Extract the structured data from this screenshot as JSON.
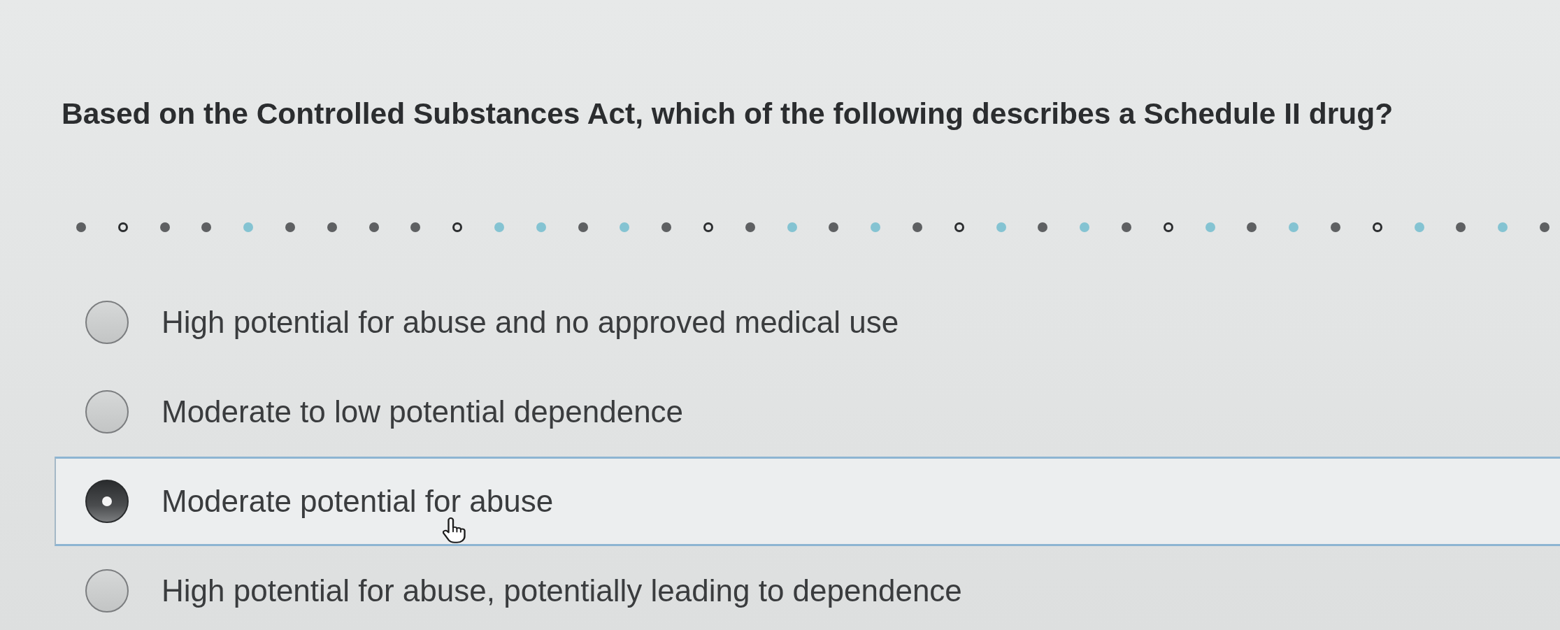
{
  "question": {
    "text": "Based on the Controlled Substances Act, which of the following describes a Schedule II drug?"
  },
  "progress_dots": [
    {
      "kind": "filled",
      "color": "#5e6062"
    },
    {
      "kind": "ring",
      "color": "#2c2e30"
    },
    {
      "kind": "filled",
      "color": "#5e6062"
    },
    {
      "kind": "filled",
      "color": "#5e6062"
    },
    {
      "kind": "filled",
      "color": "#84c3d2"
    },
    {
      "kind": "filled",
      "color": "#5e6062"
    },
    {
      "kind": "filled",
      "color": "#5e6062"
    },
    {
      "kind": "filled",
      "color": "#5e6062"
    },
    {
      "kind": "filled",
      "color": "#5e6062"
    },
    {
      "kind": "ring",
      "color": "#2c2e30"
    },
    {
      "kind": "filled",
      "color": "#84c3d2"
    },
    {
      "kind": "filled",
      "color": "#84c3d2"
    },
    {
      "kind": "filled",
      "color": "#5e6062"
    },
    {
      "kind": "filled",
      "color": "#84c3d2"
    },
    {
      "kind": "filled",
      "color": "#5e6062"
    },
    {
      "kind": "ring",
      "color": "#2c2e30"
    },
    {
      "kind": "filled",
      "color": "#5e6062"
    },
    {
      "kind": "filled",
      "color": "#84c3d2"
    },
    {
      "kind": "filled",
      "color": "#5e6062"
    },
    {
      "kind": "filled",
      "color": "#84c3d2"
    },
    {
      "kind": "filled",
      "color": "#5e6062"
    },
    {
      "kind": "ring",
      "color": "#2c2e30"
    },
    {
      "kind": "filled",
      "color": "#84c3d2"
    },
    {
      "kind": "filled",
      "color": "#5e6062"
    },
    {
      "kind": "filled",
      "color": "#84c3d2"
    },
    {
      "kind": "filled",
      "color": "#5e6062"
    },
    {
      "kind": "ring",
      "color": "#2c2e30"
    },
    {
      "kind": "filled",
      "color": "#84c3d2"
    },
    {
      "kind": "filled",
      "color": "#5e6062"
    },
    {
      "kind": "filled",
      "color": "#84c3d2"
    },
    {
      "kind": "filled",
      "color": "#5e6062"
    },
    {
      "kind": "ring",
      "color": "#2c2e30"
    },
    {
      "kind": "filled",
      "color": "#84c3d2"
    },
    {
      "kind": "filled",
      "color": "#5e6062"
    },
    {
      "kind": "filled",
      "color": "#84c3d2"
    },
    {
      "kind": "filled",
      "color": "#5e6062"
    }
  ],
  "options": [
    {
      "label": "High potential for abuse and no approved medical use",
      "selected": false,
      "hovered": false
    },
    {
      "label": "Moderate to low potential dependence",
      "selected": false,
      "hovered": false
    },
    {
      "label": "Moderate potential for abuse",
      "selected": true,
      "hovered": true
    },
    {
      "label": "High potential for abuse, potentially leading to dependence",
      "selected": false,
      "hovered": false
    }
  ]
}
